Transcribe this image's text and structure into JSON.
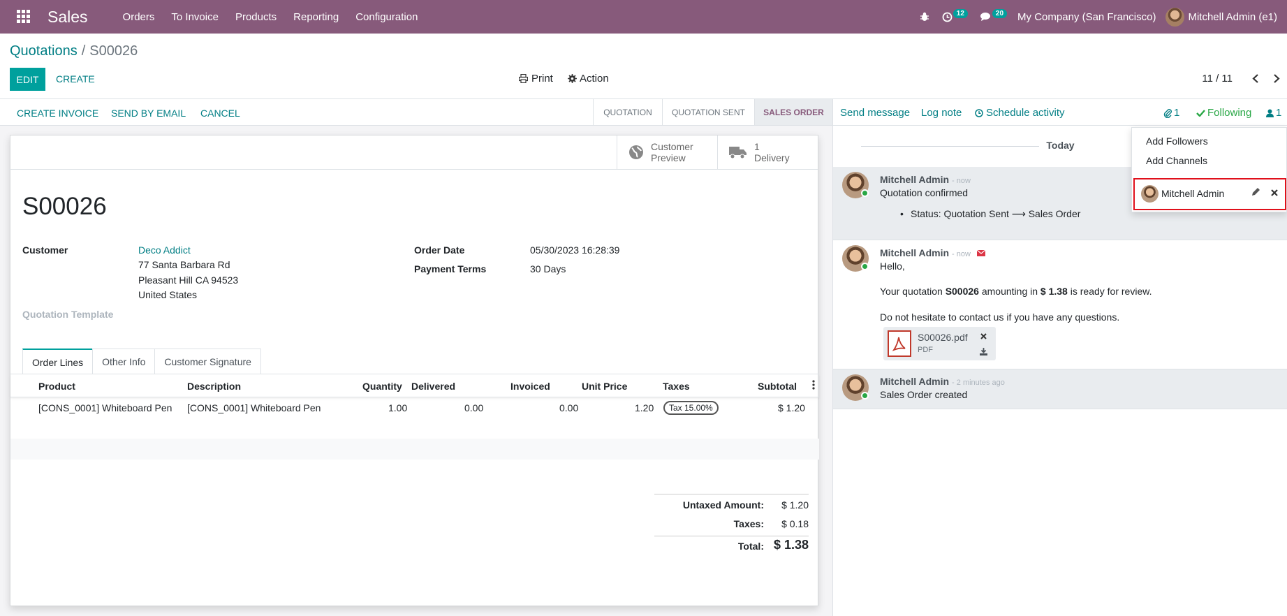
{
  "navbar": {
    "app_name": "Sales",
    "menu": [
      "Orders",
      "To Invoice",
      "Products",
      "Reporting",
      "Configuration"
    ],
    "activity_count": "12",
    "message_count": "20",
    "company": "My Company (San Francisco)",
    "user": "Mitchell Admin (e1)",
    "bg_color": "#875a7b"
  },
  "control_panel": {
    "breadcrumb_parent": "Quotations",
    "breadcrumb_separator": "/",
    "breadcrumb_current": "S00026",
    "edit_label": "EDIT",
    "create_label": "CREATE",
    "print_label": "Print",
    "action_label": "Action",
    "pager": "11 / 11"
  },
  "statusbar": {
    "buttons": [
      "CREATE INVOICE",
      "SEND BY EMAIL",
      "CANCEL"
    ],
    "stages": [
      "QUOTATION",
      "QUOTATION SENT",
      "SALES ORDER"
    ],
    "active_stage": "SALES ORDER"
  },
  "smart_buttons": {
    "preview_line1": "Customer",
    "preview_line2": "Preview",
    "delivery_count": "1",
    "delivery_label": "Delivery"
  },
  "order": {
    "name": "S00026",
    "customer_label": "Customer",
    "customer_name": "Deco Addict",
    "address_line1": "77 Santa Barbara Rd",
    "address_line2": "Pleasant Hill CA 94523",
    "address_line3": "United States",
    "template_label": "Quotation Template",
    "order_date_label": "Order Date",
    "order_date": "05/30/2023 16:28:39",
    "payment_terms_label": "Payment Terms",
    "payment_terms": "30 Days"
  },
  "tabs": [
    "Order Lines",
    "Other Info",
    "Customer Signature"
  ],
  "table": {
    "headers": [
      "Product",
      "Description",
      "Quantity",
      "Delivered",
      "Invoiced",
      "Unit Price",
      "Taxes",
      "Subtotal"
    ],
    "rows": [
      {
        "product": "[CONS_0001] Whiteboard Pen",
        "description": "[CONS_0001] Whiteboard Pen",
        "quantity": "1.00",
        "delivered": "0.00",
        "invoiced": "0.00",
        "unit_price": "1.20",
        "taxes": "Tax 15.00%",
        "subtotal": "$ 1.20"
      }
    ]
  },
  "totals": {
    "untaxed_label": "Untaxed Amount:",
    "untaxed_value": "$ 1.20",
    "taxes_label": "Taxes:",
    "taxes_value": "$ 0.18",
    "total_label": "Total:",
    "total_value": "$ 1.38"
  },
  "chatter": {
    "send_message": "Send message",
    "log_note": "Log note",
    "schedule_activity": "Schedule activity",
    "attachment_count": "1",
    "following_label": "Following",
    "follower_count": "1",
    "today_label": "Today",
    "messages": [
      {
        "author": "Mitchell Admin",
        "date": "- now",
        "text": "Quotation confirmed",
        "tracking": "Status: Quotation Sent ⟶ Sales Order"
      },
      {
        "author": "Mitchell Admin",
        "date": "- now",
        "greeting": "Hello,",
        "body_pre": "Your quotation ",
        "body_ref": "S00026",
        "body_mid": " amounting in ",
        "body_amount": "$ 1.38",
        "body_post": " is ready for review.",
        "body2": "Do not hesitate to contact us if you have any questions.",
        "attachment_name": "S00026.pdf",
        "attachment_type": "PDF"
      },
      {
        "author": "Mitchell Admin",
        "date": "- 2 minutes ago",
        "text": "Sales Order created"
      }
    ]
  },
  "followers_dropdown": {
    "add_followers": "Add Followers",
    "add_channels": "Add Channels",
    "follower_name": "Mitchell Admin"
  },
  "colors": {
    "primary": "#00a09d",
    "link": "#017e84",
    "brand": "#875a7b",
    "highlight_border": "#e0101b"
  }
}
